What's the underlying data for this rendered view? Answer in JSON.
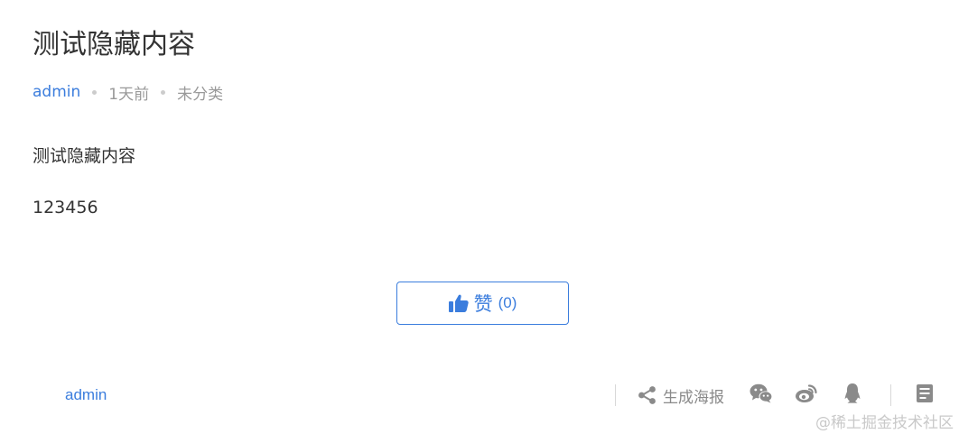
{
  "post": {
    "title": "测试隐藏内容",
    "author": "admin",
    "time": "1天前",
    "category": "未分类",
    "paragraphs": [
      "测试隐藏内容",
      "123456"
    ]
  },
  "like": {
    "label": "赞",
    "count": "(0)",
    "icon": "thumbs-up-icon"
  },
  "footer": {
    "author": "admin",
    "share_poster_label": "生成海报",
    "icons": [
      "share-icon",
      "wechat-icon",
      "weibo-icon",
      "qq-icon",
      "article-icon"
    ]
  },
  "watermark": "@稀土掘金技术社区",
  "colors": {
    "accent": "#3b7ddd",
    "text": "#333333",
    "muted": "#999999",
    "icon_gray": "#8a8a8a"
  }
}
